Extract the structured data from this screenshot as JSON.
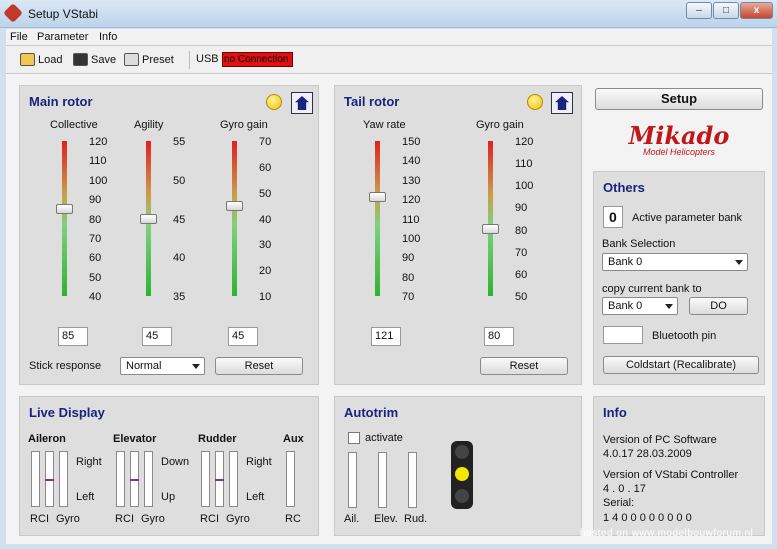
{
  "window": {
    "title": "Setup VStabi",
    "min": "–",
    "max": "□",
    "close": "x"
  },
  "menu": [
    "File",
    "Parameter",
    "Info"
  ],
  "toolbar": {
    "load": "Load",
    "save": "Save",
    "preset": "Preset",
    "usb": "USB",
    "connection": "no Connection"
  },
  "main_rotor": {
    "title": "Main rotor",
    "sliders": [
      {
        "label": "Collective",
        "ticks": [
          "120",
          "110",
          "100",
          "90",
          "80",
          "70",
          "60",
          "50",
          "40"
        ],
        "value": "85",
        "fraction": 0.56
      },
      {
        "label": "Agility",
        "ticks": [
          "55",
          "50",
          "45",
          "40",
          "35"
        ],
        "value": "45",
        "fraction": 0.5
      },
      {
        "label": "Gyro gain",
        "ticks": [
          "70",
          "60",
          "50",
          "40",
          "30",
          "20",
          "10"
        ],
        "value": "45",
        "fraction": 0.58
      }
    ],
    "stick_response_label": "Stick response",
    "stick_response": "Normal",
    "reset": "Reset"
  },
  "tail_rotor": {
    "title": "Tail rotor",
    "sliders": [
      {
        "label": "Yaw rate",
        "ticks": [
          "150",
          "140",
          "130",
          "120",
          "110",
          "100",
          "90",
          "80",
          "70"
        ],
        "value": "121",
        "fraction": 0.64
      },
      {
        "label": "Gyro gain",
        "ticks": [
          "120",
          "110",
          "100",
          "90",
          "80",
          "70",
          "60",
          "50"
        ],
        "value": "80",
        "fraction": 0.43
      }
    ],
    "reset": "Reset"
  },
  "right": {
    "setup": "Setup",
    "logo_main": "Mikado",
    "logo_sub": "Model Helicopters",
    "others_title": "Others",
    "active_bank_value": "0",
    "active_bank_label": "Active parameter bank",
    "bank_selection_label": "Bank Selection",
    "bank_selection": "Bank 0",
    "copy_label": "copy current bank to",
    "copy_value": "Bank 0",
    "do": "DO",
    "bluetooth_label": "Bluetooth pin",
    "coldstart": "Coldstart (Recalibrate)"
  },
  "live": {
    "title": "Live Display",
    "groups": [
      {
        "name": "Aileron",
        "labels": [
          "RC",
          "I",
          "Gyro"
        ],
        "top": "Right",
        "bottom": "Left",
        "mark": 0.5
      },
      {
        "name": "Elevator",
        "labels": [
          "RC",
          "I",
          "Gyro"
        ],
        "top": "Down",
        "bottom": "Up",
        "mark": 0.5
      },
      {
        "name": "Rudder",
        "labels": [
          "RC",
          "I",
          "Gyro"
        ],
        "top": "Right",
        "bottom": "Left",
        "mark": 0.5
      },
      {
        "name": "Aux",
        "labels": [
          "RC"
        ]
      }
    ]
  },
  "autotrim": {
    "title": "Autotrim",
    "activate": "activate",
    "bars": [
      "Ail.",
      "Elev.",
      "Rud."
    ]
  },
  "info": {
    "title": "Info",
    "pc_label": "Version of PC Software",
    "pc_value": "4.0.17   28.03.2009",
    "ctrl_label": "Version of VStabi Controller",
    "ctrl_value": "4 . 0 . 17",
    "serial_label": "Serial:",
    "serial_value": "1 4 0 0 0 0 0 0 0 0"
  },
  "footer": "hosted on www.modelbouwforum.nl"
}
